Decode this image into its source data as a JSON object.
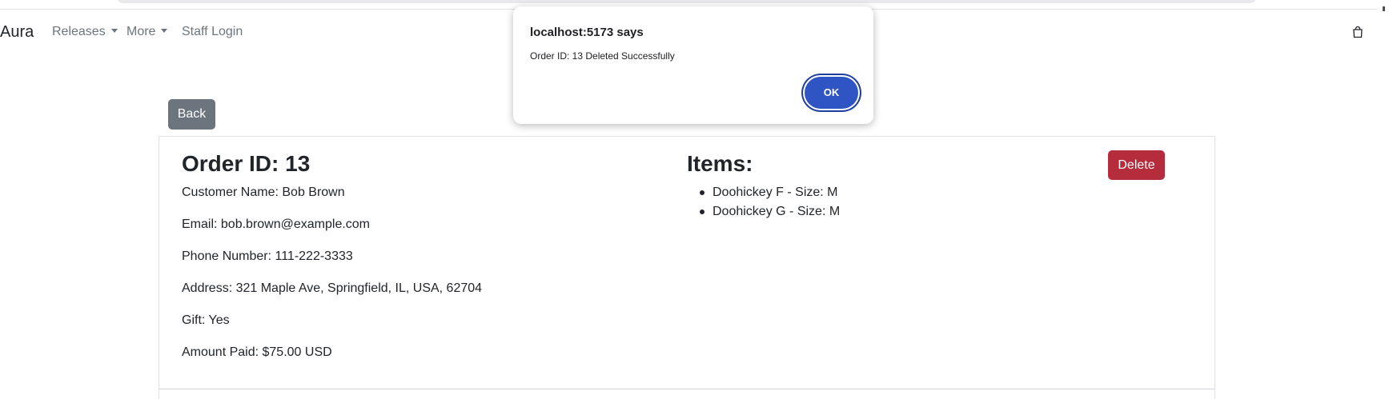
{
  "navbar": {
    "brand": "Aura",
    "items": [
      {
        "label": "Releases",
        "dropdown": true
      },
      {
        "label": "More",
        "dropdown": true
      },
      {
        "label": "Staff Login",
        "dropdown": false
      }
    ],
    "cart_icon": "shopping-bag-icon"
  },
  "back_button": {
    "label": "Back"
  },
  "order": {
    "title": "Order ID: 13",
    "details": [
      "Customer Name: Bob Brown",
      "Email: bob.brown@example.com",
      "Phone Number: 111-222-3333",
      "Address: 321 Maple Ave, Springfield, IL, USA, 62704",
      "Gift: Yes",
      "Amount Paid: $75.00 USD"
    ],
    "items_title": "Items:",
    "items": [
      "Doohickey F - Size: M",
      "Doohickey G - Size: M"
    ],
    "delete_label": "Delete"
  },
  "dialog": {
    "title": "localhost:5173 says",
    "message": "Order ID: 13 Deleted Successfully",
    "ok_label": "OK"
  },
  "colors": {
    "back_button": "#6c757d",
    "delete_button": "#b52d3c",
    "ok_button": "#2f55c5",
    "nav_link": "#6c757d"
  }
}
